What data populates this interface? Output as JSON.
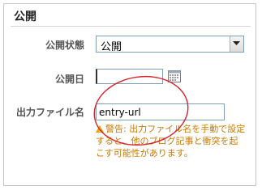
{
  "panel": {
    "title": "公開"
  },
  "fields": {
    "status": {
      "label": "公開状態",
      "selected": "公開"
    },
    "date": {
      "label": "公開日",
      "value": ""
    },
    "filename": {
      "label": "出力ファイル名",
      "value": "entry-url",
      "warning": "警告: 出力ファイル名を手動で設定すると、他のブログ記事と衝突を起こす可能性があります。"
    }
  },
  "colors": {
    "warning": "#c87a00",
    "annotation": "#d9232a",
    "input_border": "#7f9db9"
  },
  "icons": {
    "warning": "warning-triangle-icon",
    "calendar": "calendar-icon",
    "dropdown": "chevron-down-icon"
  }
}
